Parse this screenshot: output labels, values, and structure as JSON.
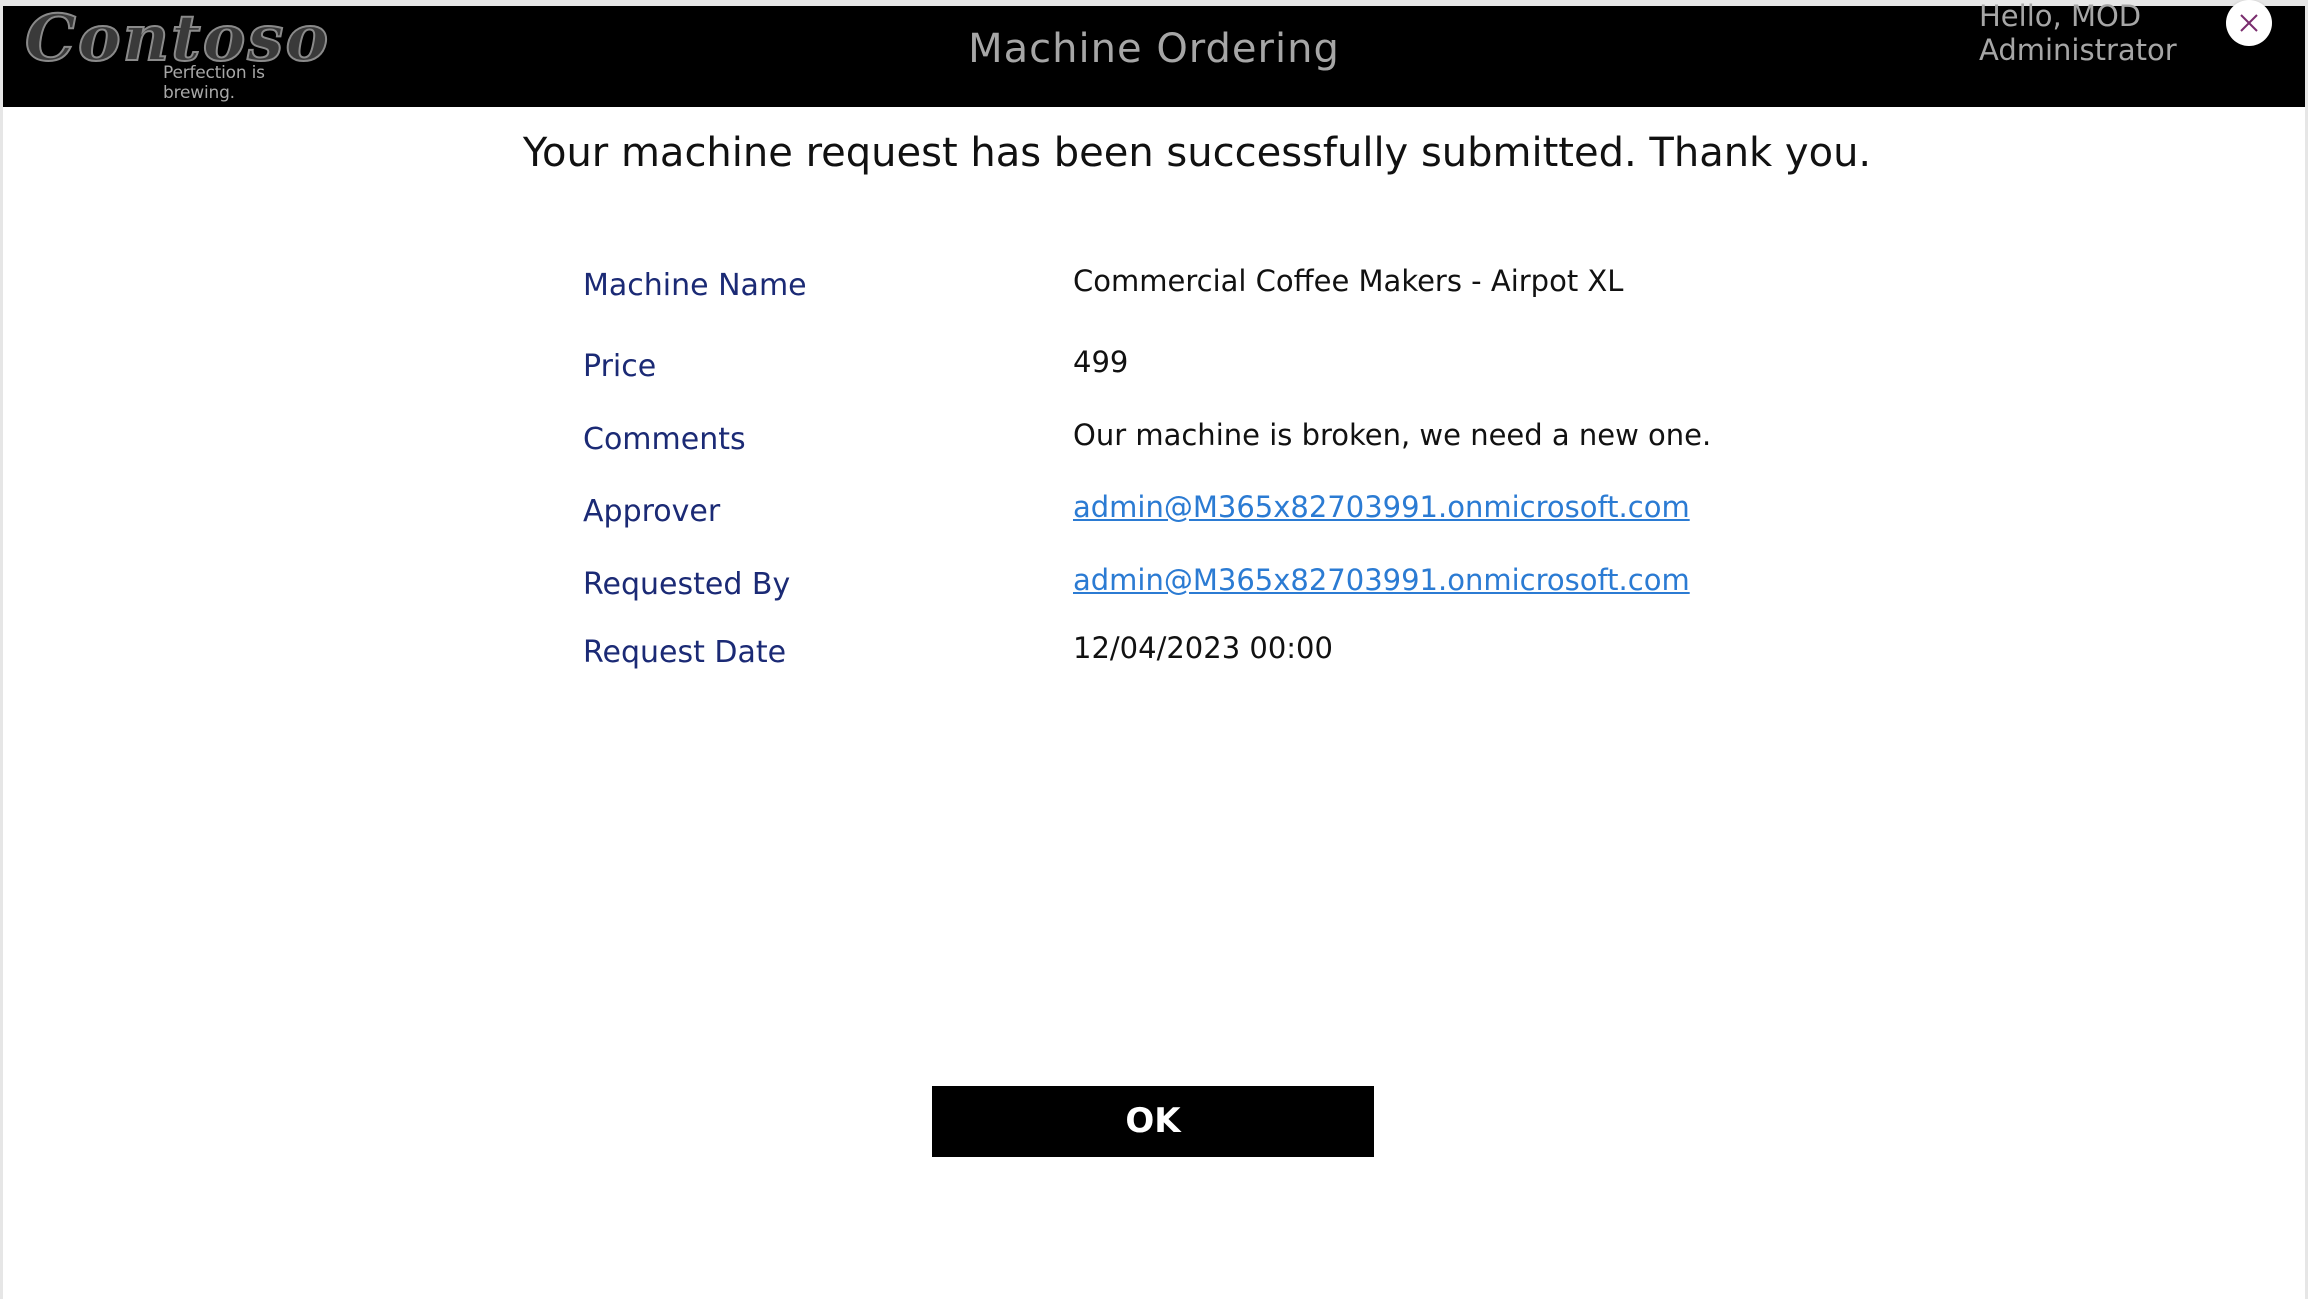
{
  "header": {
    "logo": {
      "wordmark": "Contoso",
      "tagline": "Perfection is brewing."
    },
    "title": "Machine Ordering",
    "greeting_line1": "Hello, MOD",
    "greeting_line2": "Administrator",
    "close_icon": "close-icon"
  },
  "main": {
    "success_message": "Your machine request has been successfully submitted. Thank you.",
    "details": [
      {
        "label": "Machine Name",
        "value": "Commercial Coffee Makers - Airpot XL",
        "is_link": false
      },
      {
        "label": "Price",
        "value": "499",
        "is_link": false
      },
      {
        "label": "Comments",
        "value": "Our machine is broken, we need a new one.",
        "is_link": false
      },
      {
        "label": "Approver",
        "value": "admin@M365x82703991.onmicrosoft.com",
        "is_link": true
      },
      {
        "label": "Requested By",
        "value": "admin@M365x82703991.onmicrosoft.com",
        "is_link": true
      },
      {
        "label": "Request Date",
        "value": "12/04/2023 00:00",
        "is_link": false
      }
    ],
    "ok_label": "OK"
  },
  "colors": {
    "header_bg": "#000000",
    "header_text": "#a6a6a6",
    "label_color": "#1b2a75",
    "link_color": "#2b7bd3",
    "button_bg": "#000000",
    "button_text": "#ffffff"
  }
}
